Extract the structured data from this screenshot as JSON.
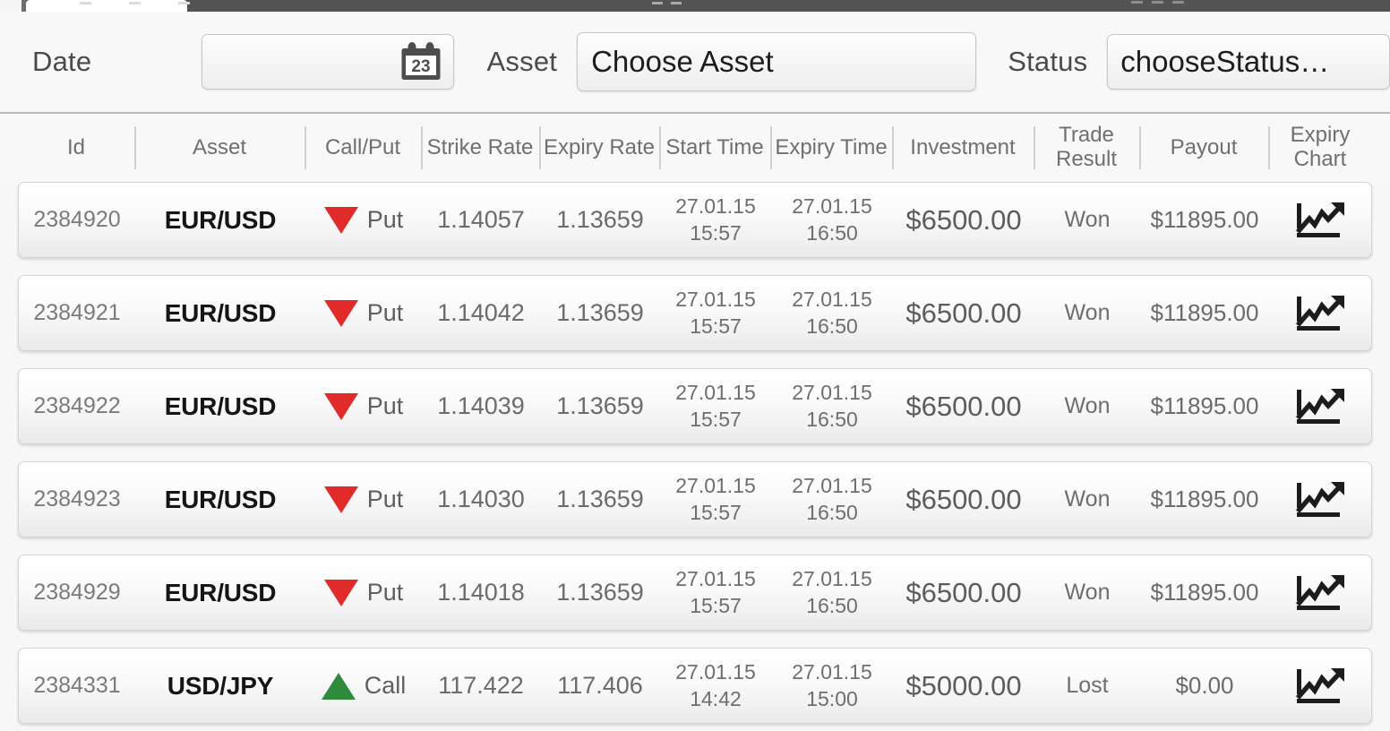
{
  "browser": {
    "tab_title": ""
  },
  "filters": {
    "date": {
      "label": "Date",
      "value": "",
      "placeholder": "",
      "icon": "calendar-icon",
      "icon_day": "23"
    },
    "asset": {
      "label": "Asset",
      "value": "Choose Asset"
    },
    "status": {
      "label": "Status",
      "value": "chooseStatus…"
    }
  },
  "table": {
    "columns": [
      "Id",
      "Asset",
      "Call/Put",
      "Strike Rate",
      "Expiry Rate",
      "Start Time",
      "Expiry Time",
      "Investment",
      "Trade Result",
      "Payout",
      "Expiry Chart"
    ],
    "rows": [
      {
        "id": "2384920",
        "asset": "EUR/USD",
        "direction": "Put",
        "direction_icon": "triangle-down-icon",
        "strike_rate": "1.14057",
        "expiry_rate": "1.13659",
        "start_date": "27.01.15",
        "start_time": "15:57",
        "expiry_date": "27.01.15",
        "expiry_time": "16:50",
        "investment": "$6500.00",
        "trade_result": "Won",
        "payout": "$11895.00",
        "chart_icon": "line-chart-icon"
      },
      {
        "id": "2384921",
        "asset": "EUR/USD",
        "direction": "Put",
        "direction_icon": "triangle-down-icon",
        "strike_rate": "1.14042",
        "expiry_rate": "1.13659",
        "start_date": "27.01.15",
        "start_time": "15:57",
        "expiry_date": "27.01.15",
        "expiry_time": "16:50",
        "investment": "$6500.00",
        "trade_result": "Won",
        "payout": "$11895.00",
        "chart_icon": "line-chart-icon"
      },
      {
        "id": "2384922",
        "asset": "EUR/USD",
        "direction": "Put",
        "direction_icon": "triangle-down-icon",
        "strike_rate": "1.14039",
        "expiry_rate": "1.13659",
        "start_date": "27.01.15",
        "start_time": "15:57",
        "expiry_date": "27.01.15",
        "expiry_time": "16:50",
        "investment": "$6500.00",
        "trade_result": "Won",
        "payout": "$11895.00",
        "chart_icon": "line-chart-icon"
      },
      {
        "id": "2384923",
        "asset": "EUR/USD",
        "direction": "Put",
        "direction_icon": "triangle-down-icon",
        "strike_rate": "1.14030",
        "expiry_rate": "1.13659",
        "start_date": "27.01.15",
        "start_time": "15:57",
        "expiry_date": "27.01.15",
        "expiry_time": "16:50",
        "investment": "$6500.00",
        "trade_result": "Won",
        "payout": "$11895.00",
        "chart_icon": "line-chart-icon"
      },
      {
        "id": "2384929",
        "asset": "EUR/USD",
        "direction": "Put",
        "direction_icon": "triangle-down-icon",
        "strike_rate": "1.14018",
        "expiry_rate": "1.13659",
        "start_date": "27.01.15",
        "start_time": "15:57",
        "expiry_date": "27.01.15",
        "expiry_time": "16:50",
        "investment": "$6500.00",
        "trade_result": "Won",
        "payout": "$11895.00",
        "chart_icon": "line-chart-icon"
      },
      {
        "id": "2384331",
        "asset": "USD/JPY",
        "direction": "Call",
        "direction_icon": "triangle-up-icon",
        "strike_rate": "117.422",
        "expiry_rate": "117.406",
        "start_date": "27.01.15",
        "start_time": "14:42",
        "expiry_date": "27.01.15",
        "expiry_time": "15:00",
        "investment": "$5000.00",
        "trade_result": "Lost",
        "payout": "$0.00",
        "chart_icon": "line-chart-icon"
      }
    ]
  },
  "colors": {
    "put_red": "#e02b2b",
    "call_green": "#2f8a3c",
    "page_bg": "#f7f7f7",
    "chrome_bar": "#535353"
  }
}
